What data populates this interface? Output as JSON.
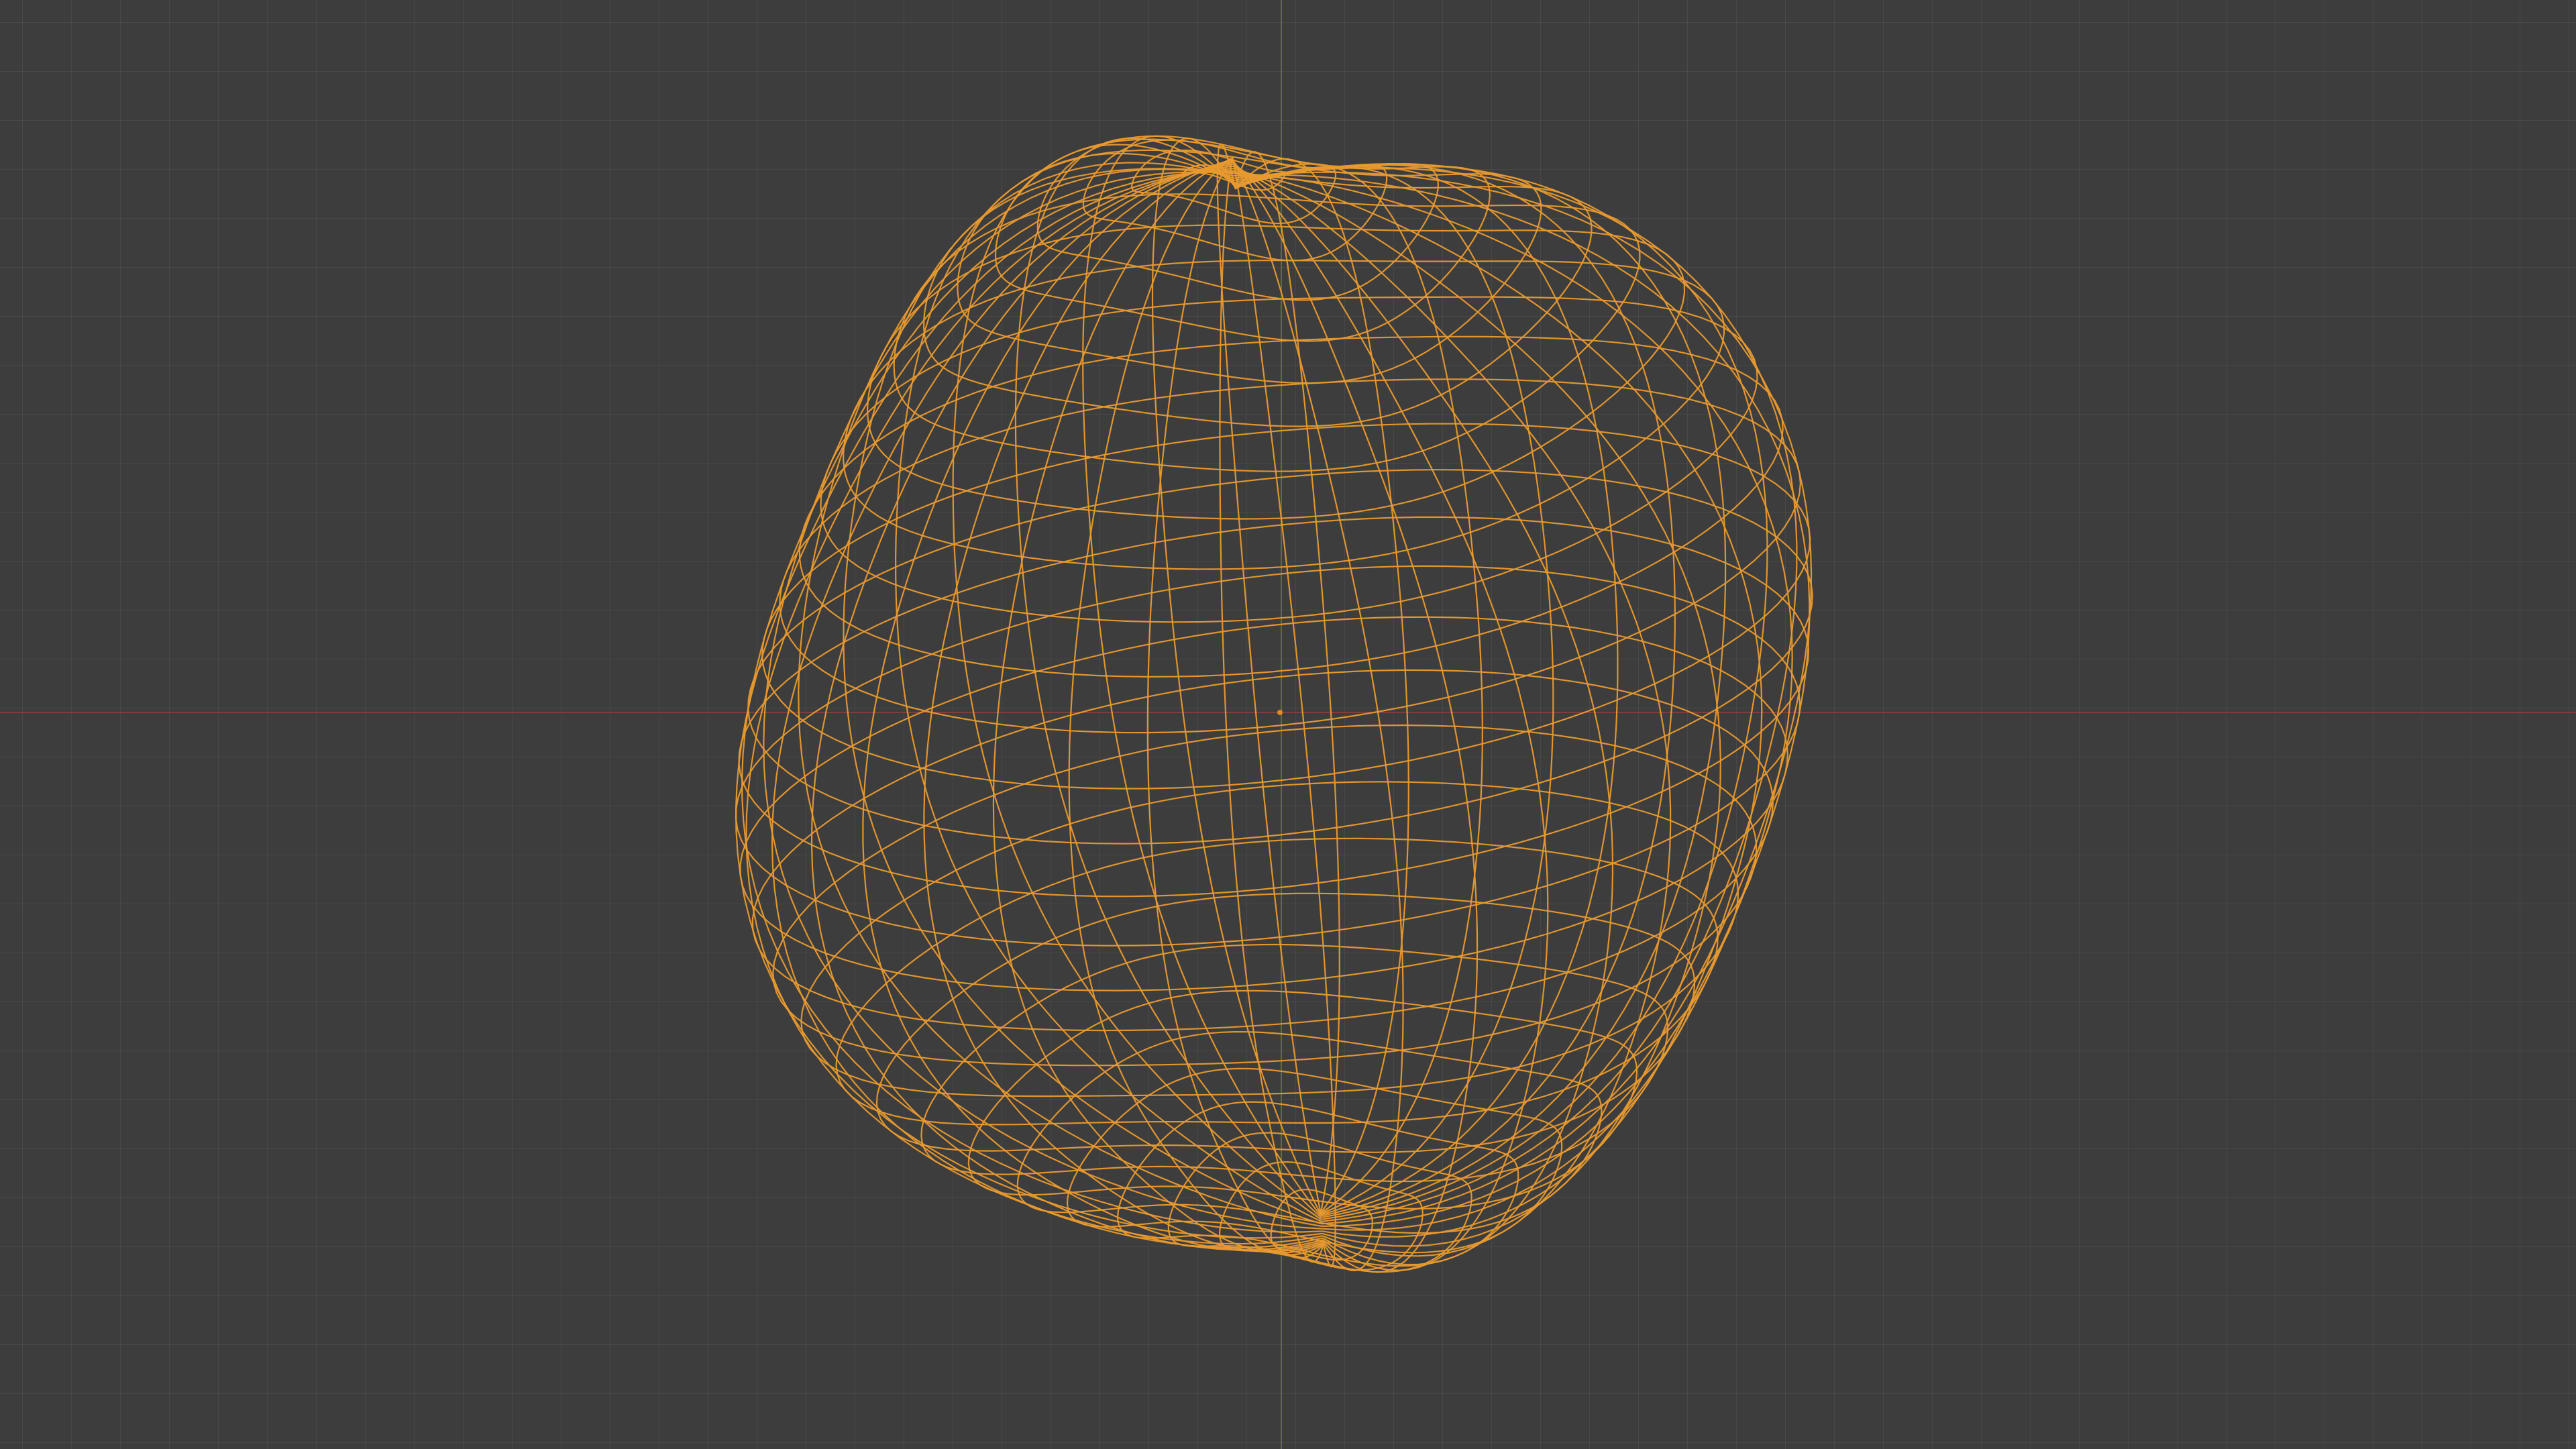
{
  "viewport": {
    "mode": "wireframe",
    "object": "deformed-sphere",
    "colors": {
      "background": "#3d3d3d",
      "grid": "#4a4a4a",
      "x_axis": "#8a3e3e",
      "y_axis": "#66763a",
      "wire": "#e89a2f",
      "origin": "#e08b1f"
    },
    "mesh": {
      "segments_u": 40,
      "segments_v": 32
    }
  }
}
